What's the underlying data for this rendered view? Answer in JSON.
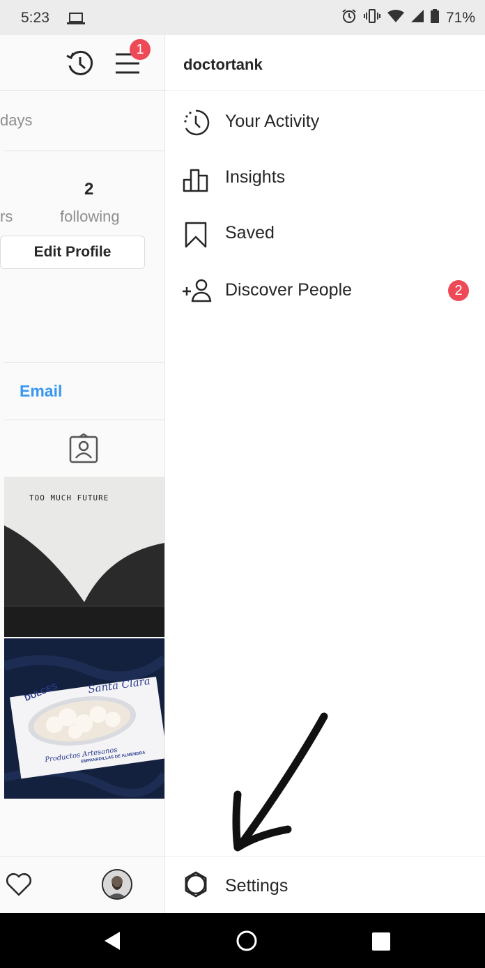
{
  "status_bar": {
    "time": "5:23",
    "battery_percent": "71%",
    "icons": [
      "laptop-icon",
      "alarm-icon",
      "vibrate-icon",
      "wifi-icon",
      "signal-icon",
      "battery-icon"
    ]
  },
  "profile": {
    "days_text": "days",
    "following_count": "2",
    "followers_fragment": "rs",
    "following_label": "following",
    "edit_profile_label": "Edit Profile",
    "email_label": "Email",
    "menu_badge_count": "1",
    "posts": [
      {
        "caption_text": "TOO MUCH FUTURE"
      },
      {
        "box_text": "DULCES",
        "box_script": "Santa Clara",
        "box_sub": "Productos Artesanos",
        "box_small": "EMPANADILLAS DE ALMENDRA"
      }
    ]
  },
  "drawer": {
    "username": "doctortank",
    "items": [
      {
        "label": "Your Activity",
        "icon": "activity-icon"
      },
      {
        "label": "Insights",
        "icon": "insights-icon"
      },
      {
        "label": "Saved",
        "icon": "bookmark-icon"
      },
      {
        "label": "Discover People",
        "icon": "add-person-icon",
        "badge": "2"
      }
    ],
    "settings_label": "Settings"
  },
  "colors": {
    "badge": "#ed4956",
    "link": "#3897f0",
    "text": "#262626",
    "muted": "#8e8e8e"
  }
}
